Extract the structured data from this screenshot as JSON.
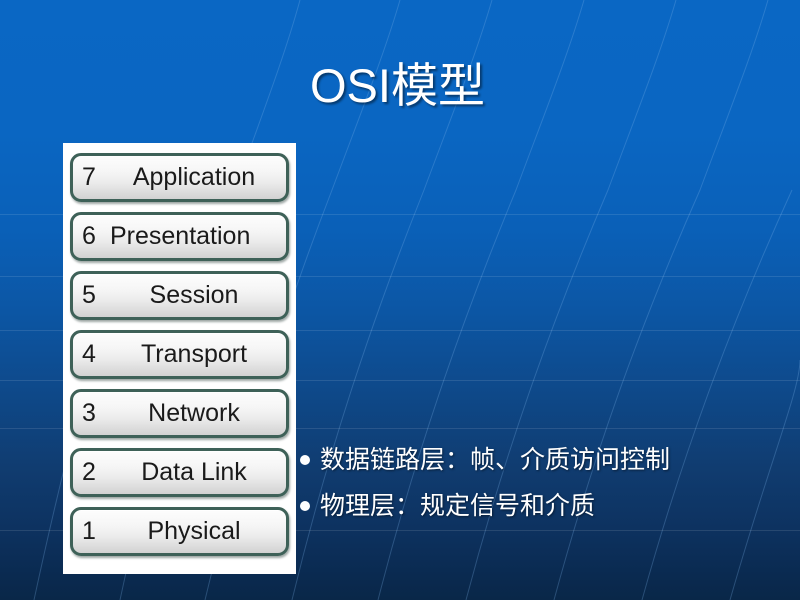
{
  "slide": {
    "title": "OSI模型",
    "background": {
      "top_color": "#0a67c4",
      "bottom_color": "#092748",
      "accent_line_color": "#6fa8dc"
    }
  },
  "osi_stack": {
    "panel_background": "#ffffff",
    "box_border_color": "#3e6158",
    "layers": [
      {
        "number": "7",
        "label": "Application"
      },
      {
        "number": "6",
        "label": "Presentation"
      },
      {
        "number": "5",
        "label": "Session"
      },
      {
        "number": "4",
        "label": "Transport"
      },
      {
        "number": "3",
        "label": "Network"
      },
      {
        "number": "2",
        "label": "Data Link"
      },
      {
        "number": "1",
        "label": "Physical"
      }
    ]
  },
  "bullets": [
    {
      "text": "数据链路层：帧、介质访问控制"
    },
    {
      "text": "物理层：规定信号和介质"
    }
  ]
}
